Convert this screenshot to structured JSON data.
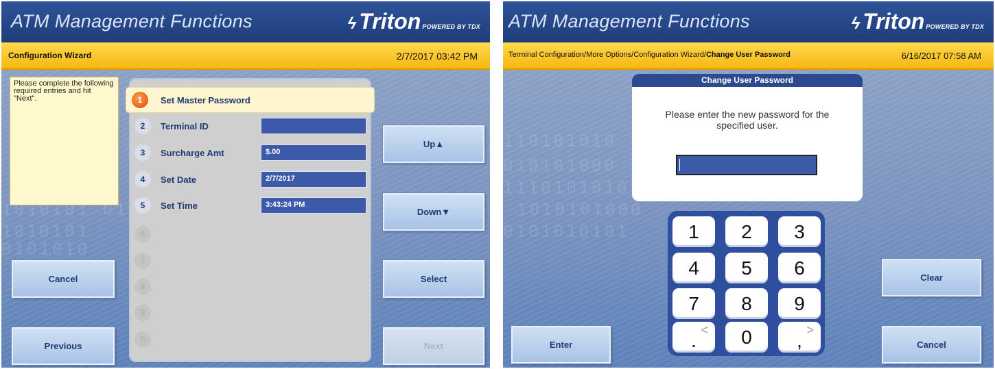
{
  "left": {
    "header_title": "ATM Management Functions",
    "logo": {
      "brand": "Triton",
      "sub": "POWERED BY",
      "maker": "TDX"
    },
    "breadcrumb": "Configuration Wizard",
    "datetime": "2/7/2017  03:42 PM",
    "help_text": "Please complete the following required entries and hit \"Next\".",
    "items": [
      {
        "num": "1",
        "label": "Set Master Password",
        "value": ""
      },
      {
        "num": "2",
        "label": "Terminal ID",
        "value": ""
      },
      {
        "num": "3",
        "label": "Surcharge Amt",
        "value": "$.00"
      },
      {
        "num": "4",
        "label": "Set Date",
        "value": "2/7/2017"
      },
      {
        "num": "5",
        "label": "Set Time",
        "value": "3:43:24 PM"
      },
      {
        "num": "6"
      },
      {
        "num": "7"
      },
      {
        "num": "8"
      },
      {
        "num": "9"
      },
      {
        "num": "0"
      }
    ],
    "buttons": {
      "cancel": "Cancel",
      "previous": "Previous",
      "up": "Up▲",
      "down": "Down▼",
      "select": "Select",
      "next": "Next"
    }
  },
  "right": {
    "header_title": "ATM Management Functions",
    "logo": {
      "brand": "Triton",
      "sub": "POWERED BY",
      "maker": "TDX"
    },
    "breadcrumb_path": "Terminal Configuration/More Options/Configuration Wizard/",
    "breadcrumb_current": "Change User Password",
    "datetime": "6/16/2017  07:58 AM",
    "dialog": {
      "title": "Change User Password",
      "text": "Please enter the new password for the specified user."
    },
    "keys": [
      "1",
      "2",
      "3",
      "4",
      "5",
      "6",
      "7",
      "8",
      "9",
      ".",
      "0",
      ","
    ],
    "key_sub": {
      "lt": "<",
      "gt": ">"
    },
    "buttons": {
      "clear": "Clear",
      "enter": "Enter",
      "cancel": "Cancel"
    }
  },
  "colors": {
    "header_blue": "#2f5499",
    "crumb_yellow": "#f6b812",
    "field_blue": "#3d5aa8",
    "button_text": "#1e3a72"
  }
}
